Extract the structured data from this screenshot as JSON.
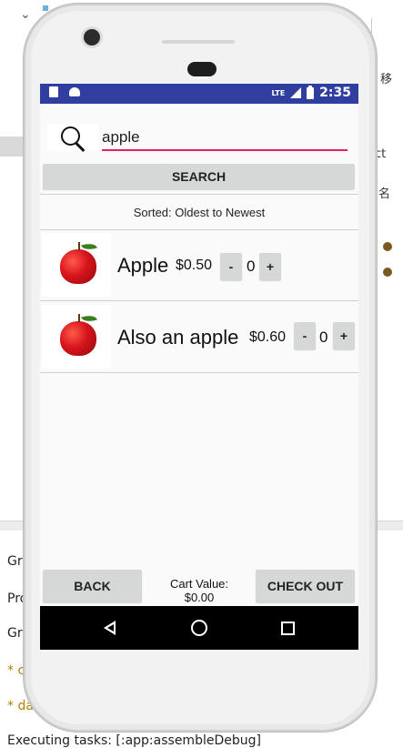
{
  "ide": {
    "right_text_1": "移",
    "right_text_2": "ct",
    "right_text_3": "名",
    "lines": [
      "Gr",
      "Pro",
      "Gr",
      "* c",
      "* da",
      "Executing tasks: [:app:assembleDebug]"
    ]
  },
  "status_bar": {
    "network": "LTE",
    "time": "2:35",
    "color": "#303f9f"
  },
  "search": {
    "query": "apple",
    "button_label": "SEARCH",
    "underline_color": "#e91e63"
  },
  "sort_label": "Sorted: Oldest to Newest",
  "items": [
    {
      "name": "Apple",
      "price": "$0.50",
      "minus": "-",
      "qty": "0",
      "plus": "+"
    },
    {
      "name": "Also an apple",
      "price": "$0.60",
      "minus": "-",
      "qty": "0",
      "plus": "+"
    }
  ],
  "footer": {
    "back_label": "BACK",
    "cart_label": "Cart Value:",
    "cart_value": "$0.00",
    "checkout_label": "CHECK OUT"
  }
}
